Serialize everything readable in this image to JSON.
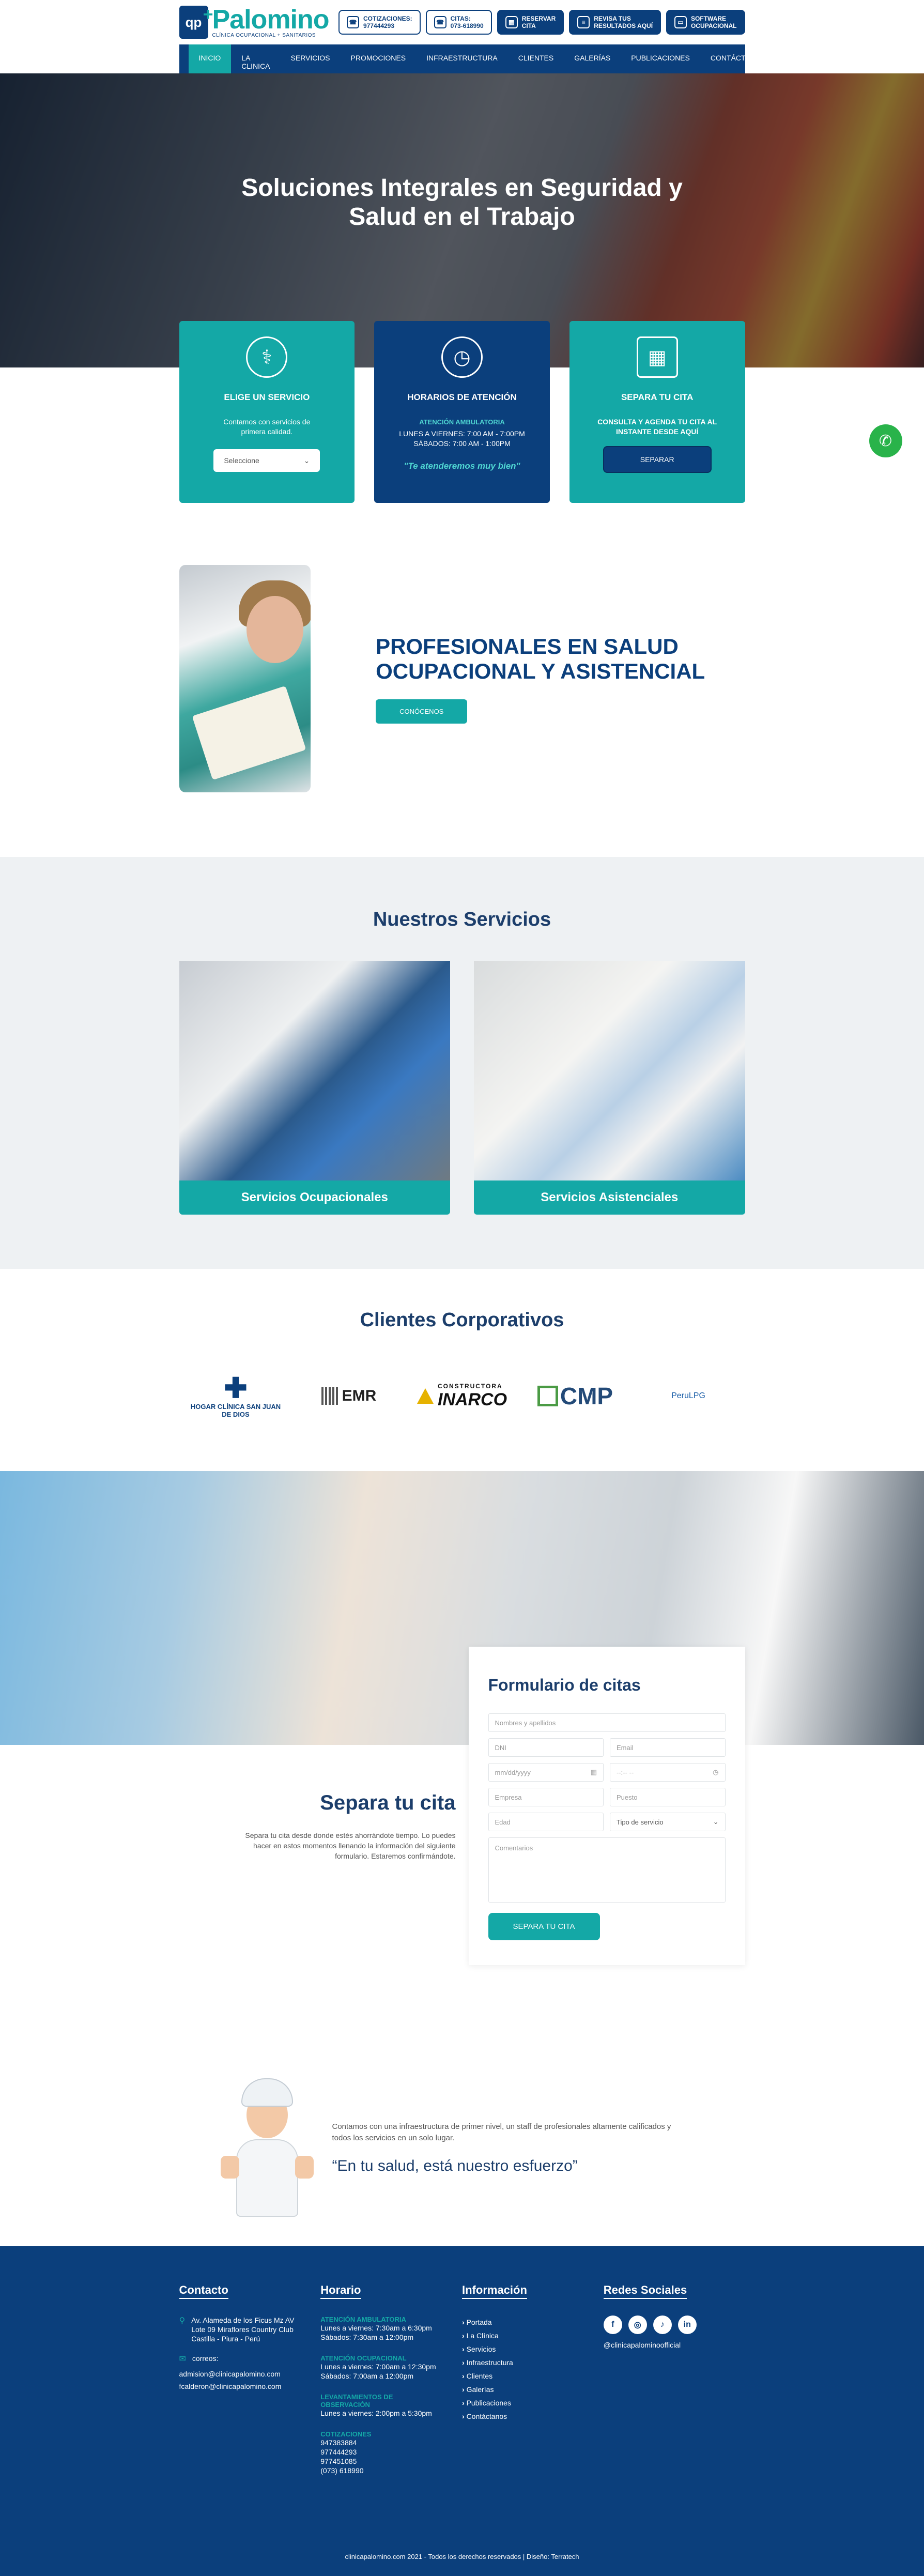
{
  "header": {
    "logo_mark": "qp",
    "logo_name": "Palomino",
    "logo_sub": "CLÍNICA OCUPACIONAL + SANITARIOS",
    "buttons": [
      {
        "label1": "COTIZACIONES:",
        "label2": "977444293"
      },
      {
        "label1": "CITAS:",
        "label2": "073-618990"
      },
      {
        "label1": "RESERVAR",
        "label2": "CITA"
      },
      {
        "label1": "REVISA TUS",
        "label2": "RESULTADOS AQUÍ"
      },
      {
        "label1": "SOFTWARE",
        "label2": "OCUPACIONAL"
      }
    ]
  },
  "nav": [
    "INICIO",
    "LA CLINICA",
    "SERVICIOS",
    "PROMOCIONES",
    "INFRAESTRUCTURA",
    "CLIENTES",
    "GALERÍAS",
    "PUBLICACIONES",
    "CONTÁCTANOS"
  ],
  "hero": {
    "title": "Soluciones Integrales en Seguridad y Salud en el Trabajo"
  },
  "cards": {
    "servicio": {
      "title": "ELIGE UN SERVICIO",
      "text": "Contamos con servicios de primera calidad.",
      "select": "Seleccione"
    },
    "horarios": {
      "title": "HORARIOS DE ATENCIÓN",
      "sub": "ATENCIÓN AMBULATORIA",
      "line1": "LUNES A VIERNES: 7:00 AM - 7:00PM",
      "line2": "SÁBADOS: 7:00 AM - 1:00PM",
      "motto": "\"Te atenderemos muy bien\""
    },
    "cita": {
      "title": "SEPARA TU CITA",
      "text": "CONSULTA Y AGENDA TU CITA AL INSTANTE DESDE AQUÍ",
      "button": "SEPARAR"
    }
  },
  "prof": {
    "title": "PROFESIONALES EN SALUD OCUPACIONAL Y ASISTENCIAL",
    "button": "CONÓCENOS"
  },
  "servicios": {
    "title": "Nuestros Servicios",
    "items": [
      "Servicios Ocupacionales",
      "Servicios Asistenciales"
    ]
  },
  "clientes": {
    "title": "Clientes Corporativos",
    "hogar": "HOGAR CLÍNICA SAN JUAN DE DIOS",
    "emr": "EMR",
    "inarco1": "CONSTRUCTORA",
    "inarco2": "INARCO",
    "cmp": "CMP",
    "peru": "PeruLPG"
  },
  "form": {
    "title": "Formulario de citas",
    "nombres": "Nombres y apellidos",
    "dni": "DNI",
    "email": "Email",
    "fecha": "mm/dd/yyyy",
    "hora": "--:-- --",
    "empresa": "Empresa",
    "puesto": "Puesto",
    "edad": "Edad",
    "tipo": "Tipo de servicio",
    "comentarios": "Comentarios",
    "button": "SEPARA TU CITA"
  },
  "cita_left": {
    "title": "Separa tu cita",
    "text": "Separa tu cita desde donde estés ahorrándote tiempo. Lo puedes hacer en estos momentos llenando la información del siguiente formulario. Estaremos confirmándote."
  },
  "strip": {
    "text": "Contamos con una infraestructura de primer nivel, un staff de profesionales altamente calificados y todos los servicios en un solo lugar.",
    "quote": "“En tu salud, está nuestro esfuerzo”"
  },
  "footer": {
    "contacto": {
      "title": "Contacto",
      "address": "Av. Alameda de los Ficus Mz AV Lote 09 Miraflores Country Club Castilla - Piura - Perú",
      "correos_label": "correos:",
      "email1": "admision@clinicapalomino.com",
      "email2": "fcalderon@clinicapalomino.com"
    },
    "horario": {
      "title": "Horario",
      "h1": "ATENCIÓN AMBULATORIA",
      "h1a": "Lunes a viernes: 7:30am a 6:30pm",
      "h1b": "Sábados: 7:30am a 12:00pm",
      "h2": "ATENCIÓN OCUPACIONAL",
      "h2a": "Lunes a viernes: 7:00am a 12:30pm",
      "h2b": "Sábados: 7:00am a 12:00pm",
      "h3": "LEVANTAMIENTOS DE OBSERVACIÓN",
      "h3a": "Lunes a viernes: 2:00pm a 5:30pm",
      "h4": "COTIZACIONES",
      "p1": "947383884",
      "p2": "977444293",
      "p3": "977451085",
      "p4": "(073) 618990"
    },
    "informacion": {
      "title": "Información",
      "links": [
        "Portada",
        "La Clínica",
        "Servicios",
        "Infraestructura",
        "Clientes",
        "Galerías",
        "Publicaciones",
        "Contáctanos"
      ]
    },
    "redes": {
      "title": "Redes Sociales",
      "handle": "@clinicapalominoofficial"
    },
    "copyright": "clinicapalomino.com 2021 - Todos los derechos reservados | Diseño: Terratech"
  }
}
